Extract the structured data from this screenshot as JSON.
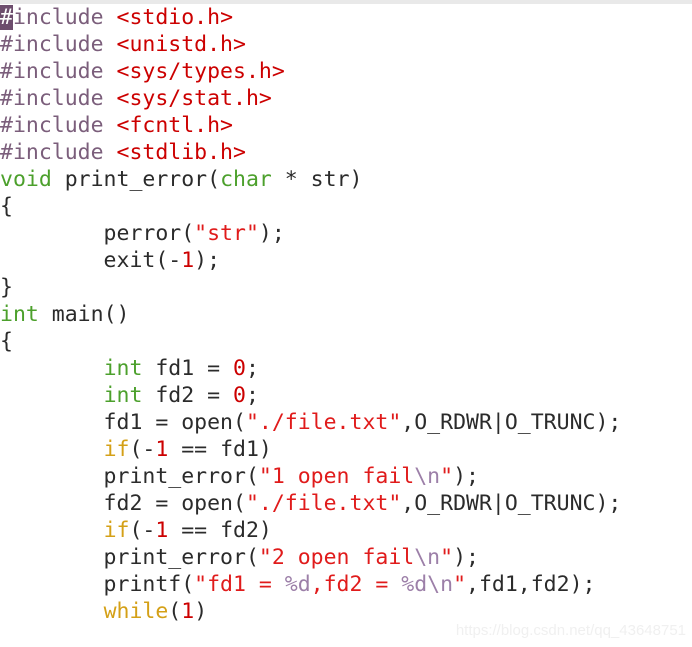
{
  "editor": {
    "background": "#ffffff",
    "language": "C",
    "cursor_color": "#6d4d6d",
    "palette": {
      "plain": "#2b2b2b",
      "preprocessor": "#7b5e7b",
      "header": "#cc0000",
      "type": "#4ca02c",
      "keyword": "#d4a017",
      "string": "#e01b1b",
      "number": "#cc0000",
      "escape": "#9c7fa8"
    }
  },
  "watermark": {
    "text": "https://blog.csdn.net/qq_43648751"
  },
  "code": {
    "lines": [
      {
        "n": 1,
        "tokens": [
          {
            "t": "#",
            "c": "tok-pre tok-cursor"
          },
          {
            "t": "include ",
            "c": "tok-pre"
          },
          {
            "t": "<stdio.h>",
            "c": "tok-header"
          }
        ]
      },
      {
        "n": 2,
        "tokens": [
          {
            "t": "#include ",
            "c": "tok-pre"
          },
          {
            "t": "<unistd.h>",
            "c": "tok-header"
          }
        ]
      },
      {
        "n": 3,
        "tokens": [
          {
            "t": "#include ",
            "c": "tok-pre"
          },
          {
            "t": "<sys/types.h>",
            "c": "tok-header"
          }
        ]
      },
      {
        "n": 4,
        "tokens": [
          {
            "t": "#include ",
            "c": "tok-pre"
          },
          {
            "t": "<sys/stat.h>",
            "c": "tok-header"
          }
        ]
      },
      {
        "n": 5,
        "tokens": [
          {
            "t": "#include ",
            "c": "tok-pre"
          },
          {
            "t": "<fcntl.h>",
            "c": "tok-header"
          }
        ]
      },
      {
        "n": 6,
        "tokens": [
          {
            "t": "#include ",
            "c": "tok-pre"
          },
          {
            "t": "<stdlib.h>",
            "c": "tok-header"
          }
        ]
      },
      {
        "n": 7,
        "tokens": [
          {
            "t": "void",
            "c": "tok-type"
          },
          {
            "t": " print_error(",
            "c": "tok-plain"
          },
          {
            "t": "char",
            "c": "tok-type"
          },
          {
            "t": " * str)",
            "c": "tok-plain"
          }
        ]
      },
      {
        "n": 8,
        "tokens": [
          {
            "t": "{",
            "c": "tok-plain"
          }
        ]
      },
      {
        "n": 9,
        "tokens": [
          {
            "t": "        perror(",
            "c": "tok-plain"
          },
          {
            "t": "\"str\"",
            "c": "tok-string"
          },
          {
            "t": ");",
            "c": "tok-plain"
          }
        ]
      },
      {
        "n": 10,
        "tokens": [
          {
            "t": "        exit(-",
            "c": "tok-plain"
          },
          {
            "t": "1",
            "c": "tok-number"
          },
          {
            "t": ");",
            "c": "tok-plain"
          }
        ]
      },
      {
        "n": 11,
        "tokens": [
          {
            "t": "}",
            "c": "tok-plain"
          }
        ]
      },
      {
        "n": 12,
        "tokens": [
          {
            "t": "int",
            "c": "tok-type"
          },
          {
            "t": " main()",
            "c": "tok-plain"
          }
        ]
      },
      {
        "n": 13,
        "tokens": [
          {
            "t": "{",
            "c": "tok-plain"
          }
        ]
      },
      {
        "n": 14,
        "tokens": [
          {
            "t": "        ",
            "c": "tok-plain"
          },
          {
            "t": "int",
            "c": "tok-type"
          },
          {
            "t": " fd1 = ",
            "c": "tok-plain"
          },
          {
            "t": "0",
            "c": "tok-number"
          },
          {
            "t": ";",
            "c": "tok-plain"
          }
        ]
      },
      {
        "n": 15,
        "tokens": [
          {
            "t": "        ",
            "c": "tok-plain"
          },
          {
            "t": "int",
            "c": "tok-type"
          },
          {
            "t": " fd2 = ",
            "c": "tok-plain"
          },
          {
            "t": "0",
            "c": "tok-number"
          },
          {
            "t": ";",
            "c": "tok-plain"
          }
        ]
      },
      {
        "n": 16,
        "tokens": [
          {
            "t": "        fd1 = open(",
            "c": "tok-plain"
          },
          {
            "t": "\"./file.txt\"",
            "c": "tok-string"
          },
          {
            "t": ",O_RDWR|O_TRUNC);",
            "c": "tok-plain"
          }
        ]
      },
      {
        "n": 17,
        "tokens": [
          {
            "t": "        ",
            "c": "tok-plain"
          },
          {
            "t": "if",
            "c": "tok-keyword"
          },
          {
            "t": "(-",
            "c": "tok-plain"
          },
          {
            "t": "1",
            "c": "tok-number"
          },
          {
            "t": " == fd1)",
            "c": "tok-plain"
          }
        ]
      },
      {
        "n": 18,
        "tokens": [
          {
            "t": "        print_error(",
            "c": "tok-plain"
          },
          {
            "t": "\"1 open fail",
            "c": "tok-string"
          },
          {
            "t": "\\n",
            "c": "tok-escape"
          },
          {
            "t": "\"",
            "c": "tok-string"
          },
          {
            "t": ");",
            "c": "tok-plain"
          }
        ]
      },
      {
        "n": 19,
        "tokens": [
          {
            "t": "        fd2 = open(",
            "c": "tok-plain"
          },
          {
            "t": "\"./file.txt\"",
            "c": "tok-string"
          },
          {
            "t": ",O_RDWR|O_TRUNC);",
            "c": "tok-plain"
          }
        ]
      },
      {
        "n": 20,
        "tokens": [
          {
            "t": "        ",
            "c": "tok-plain"
          },
          {
            "t": "if",
            "c": "tok-keyword"
          },
          {
            "t": "(-",
            "c": "tok-plain"
          },
          {
            "t": "1",
            "c": "tok-number"
          },
          {
            "t": " == fd2)",
            "c": "tok-plain"
          }
        ]
      },
      {
        "n": 21,
        "tokens": [
          {
            "t": "        print_error(",
            "c": "tok-plain"
          },
          {
            "t": "\"2 open fail",
            "c": "tok-string"
          },
          {
            "t": "\\n",
            "c": "tok-escape"
          },
          {
            "t": "\"",
            "c": "tok-string"
          },
          {
            "t": ");",
            "c": "tok-plain"
          }
        ]
      },
      {
        "n": 22,
        "tokens": [
          {
            "t": "        printf(",
            "c": "tok-plain"
          },
          {
            "t": "\"fd1 = ",
            "c": "tok-string"
          },
          {
            "t": "%d",
            "c": "tok-escape"
          },
          {
            "t": ",fd2 = ",
            "c": "tok-string"
          },
          {
            "t": "%d",
            "c": "tok-escape"
          },
          {
            "t": "\\n",
            "c": "tok-escape"
          },
          {
            "t": "\"",
            "c": "tok-string"
          },
          {
            "t": ",fd1,fd2);",
            "c": "tok-plain"
          }
        ]
      },
      {
        "n": 23,
        "tokens": [
          {
            "t": "        ",
            "c": "tok-plain"
          },
          {
            "t": "while",
            "c": "tok-keyword"
          },
          {
            "t": "(",
            "c": "tok-plain"
          },
          {
            "t": "1",
            "c": "tok-number"
          },
          {
            "t": ")",
            "c": "tok-plain"
          }
        ]
      }
    ]
  }
}
